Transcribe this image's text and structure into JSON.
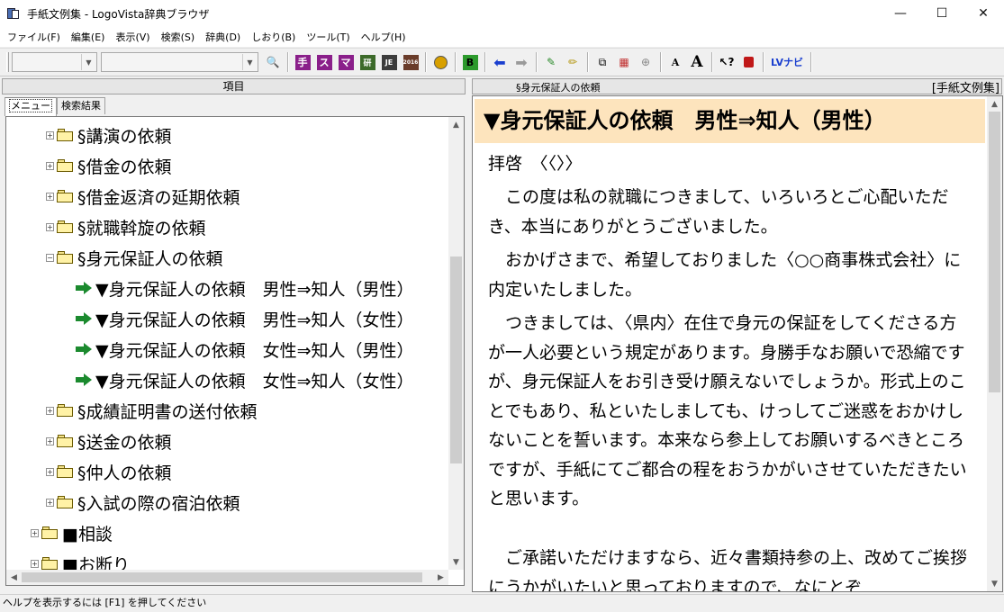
{
  "window": {
    "title": "手紙文例集 - LogoVista辞典ブラウザ",
    "minimize": "—",
    "maximize": "☐",
    "close": "✕"
  },
  "menu": [
    "ファイル(F)",
    "編集(E)",
    "表示(V)",
    "検索(S)",
    "辞典(D)",
    "しおり(B)",
    "ツール(T)",
    "ヘルプ(H)"
  ],
  "toolbar": {
    "dict_buttons": [
      {
        "label": "手",
        "color": "#8a1f8a"
      },
      {
        "label": "ス",
        "color": "#8a1f8a"
      },
      {
        "label": "マ",
        "color": "#8a1f8a"
      },
      {
        "label": "研",
        "color": "#3c6a2a"
      },
      {
        "label": "JE",
        "color": "#3c3c3c"
      },
      {
        "label": "2016",
        "color": "#6a3c2a"
      }
    ],
    "b_button": "B",
    "font_small": "A",
    "font_large": "A",
    "lv_navi": "LVナビ"
  },
  "left_pane": {
    "header": "項目",
    "tabs": [
      "メニュー",
      "検索結果"
    ],
    "tree": [
      {
        "label": "§講演の依頼",
        "type": "folder",
        "indent": 1,
        "expander": "+"
      },
      {
        "label": "§借金の依頼",
        "type": "folder",
        "indent": 1,
        "expander": "+"
      },
      {
        "label": "§借金返済の延期依頼",
        "type": "folder",
        "indent": 1,
        "expander": "+"
      },
      {
        "label": "§就職斡旋の依頼",
        "type": "folder",
        "indent": 1,
        "expander": "+"
      },
      {
        "label": "§身元保証人の依頼",
        "type": "folder",
        "indent": 1,
        "expander": "−"
      },
      {
        "label": "▼身元保証人の依頼　男性⇒知人（男性）",
        "type": "item",
        "indent": 2
      },
      {
        "label": "▼身元保証人の依頼　男性⇒知人（女性）",
        "type": "item",
        "indent": 2
      },
      {
        "label": "▼身元保証人の依頼　女性⇒知人（男性）",
        "type": "item",
        "indent": 2
      },
      {
        "label": "▼身元保証人の依頼　女性⇒知人（女性）",
        "type": "item",
        "indent": 2
      },
      {
        "label": "§成績証明書の送付依頼",
        "type": "folder",
        "indent": 1,
        "expander": "+"
      },
      {
        "label": "§送金の依頼",
        "type": "folder",
        "indent": 1,
        "expander": "+"
      },
      {
        "label": "§仲人の依頼",
        "type": "folder",
        "indent": 1,
        "expander": "+"
      },
      {
        "label": "§入試の際の宿泊依頼",
        "type": "folder",
        "indent": 1,
        "expander": "+"
      },
      {
        "label": "■相談",
        "type": "folder",
        "indent": 0,
        "expander": "+"
      },
      {
        "label": "■お断り",
        "type": "folder",
        "indent": 0,
        "expander": "+"
      }
    ]
  },
  "right_pane": {
    "header_article": "§身元保証人の依頼",
    "header_dict": "[手紙文例集]",
    "title": "▼身元保証人の依頼　男性⇒知人（男性）",
    "paragraphs": [
      "拝啓　〈〈〉〉",
      "　この度は私の就職につきまして、いろいろとご心配いただき、本当にありがとうございました。",
      "　おかげさまで、希望しておりました〈○○商事株式会社〉に内定いたしました。",
      "　つきましては、〈県内〉在住で身元の保証をしてくださる方が一人必要という規定があります。身勝手なお願いで恐縮ですが、身元保証人をお引き受け願えないでしょうか。形式上のことでもあり、私といたしましても、けっしてご迷惑をおかけしないことを誓います。本来なら参上してお願いするべきところですが、手紙にてご都合の程をおうかがいさせていただきたいと思います。",
      "　ご承諾いただけますなら、近々書類持参の上、改めてご挨拶にうかがいたいと思っておりますので、なにとぞ"
    ]
  },
  "statusbar": "ヘルプを表示するには [F1] を押してください"
}
